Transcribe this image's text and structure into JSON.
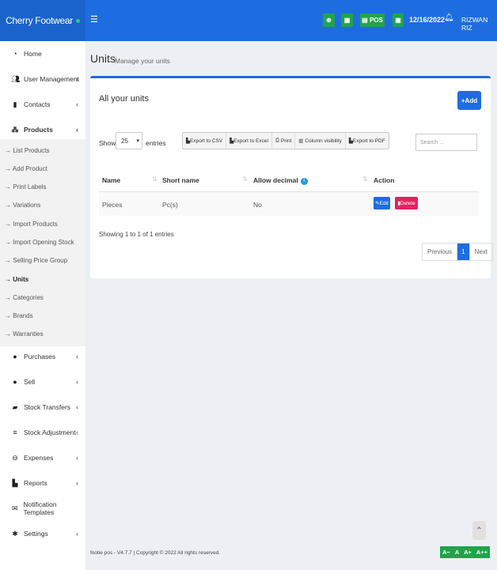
{
  "app": {
    "brand": "Cherry Footwear"
  },
  "topbar": {
    "pos_label": "POS",
    "date": "12/16/2022",
    "user": "RIZWAN RIZ"
  },
  "sidebar": {
    "items": [
      {
        "label": "Home",
        "icon": "tachometer-icon"
      },
      {
        "label": "User Management",
        "icon": "users-icon"
      },
      {
        "label": "Contacts",
        "icon": "address-book-icon"
      },
      {
        "label": "Products",
        "icon": "cubes-icon"
      },
      {
        "label": "Purchases",
        "icon": "arrow-circle-down-icon"
      },
      {
        "label": "Sell",
        "icon": "arrow-circle-up-icon"
      },
      {
        "label": "Stock Transfers",
        "icon": "truck-icon"
      },
      {
        "label": "Stock Adjustment",
        "icon": "database-icon"
      },
      {
        "label": "Expenses",
        "icon": "minus-circle-icon"
      },
      {
        "label": "Reports",
        "icon": "bar-chart-icon"
      },
      {
        "label": "Notification Templates",
        "icon": "envelope-icon"
      },
      {
        "label": "Settings",
        "icon": "cog-icon"
      }
    ],
    "product_subitems": [
      "→ List Products",
      "→ Add Product",
      "→ Print Labels",
      "→ Variations",
      "→ Import Products",
      "→ Import Opening Stock",
      "→ Selling Price Group",
      "→ Units",
      "→ Categories",
      "→ Brands",
      "→ Warranties"
    ]
  },
  "page": {
    "title": "Units",
    "subtitle": "Manage your units"
  },
  "card": {
    "title": "All your units",
    "add_label": "Add",
    "show_label": "Show",
    "page_length": "25",
    "entries_label": "entries",
    "export_buttons": [
      "Export to CSV",
      "Export to Excel",
      "Print",
      "Column visibility",
      "Export to PDF"
    ],
    "search_placeholder": "Search ..."
  },
  "table": {
    "columns": [
      "Name",
      "Short name",
      "Allow decimal",
      "Action"
    ],
    "rows": [
      {
        "name": "Pieces",
        "short_name": "Pc(s)",
        "allow_decimal": "No"
      }
    ],
    "edit_label": "Edit",
    "delete_label": "Delete",
    "info": "Showing 1 to 1 of 1 entries",
    "pager": {
      "previous": "Previous",
      "current": "1",
      "next": "Next"
    }
  },
  "footer": {
    "text": "footie pos - V4.7.7 | Copyright © 2022 All rights reserved."
  },
  "font_controls": [
    "A−",
    "A",
    "A+",
    "A++"
  ],
  "colors": {
    "primary": "#1e6de0",
    "success": "#22a34a",
    "danger": "#e0245e"
  }
}
